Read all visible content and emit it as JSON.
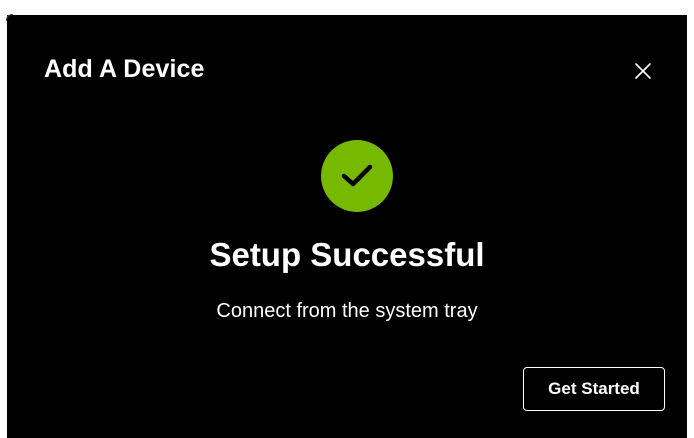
{
  "dialog": {
    "title": "Add A Device",
    "close_icon": "close-icon",
    "status_icon": "checkmark-icon",
    "headline": "Setup Successful",
    "subtext": "Connect from the system tray",
    "primary_button_label": "Get Started"
  },
  "colors": {
    "background": "#000000",
    "accent": "#76b900",
    "text": "#ffffff"
  }
}
